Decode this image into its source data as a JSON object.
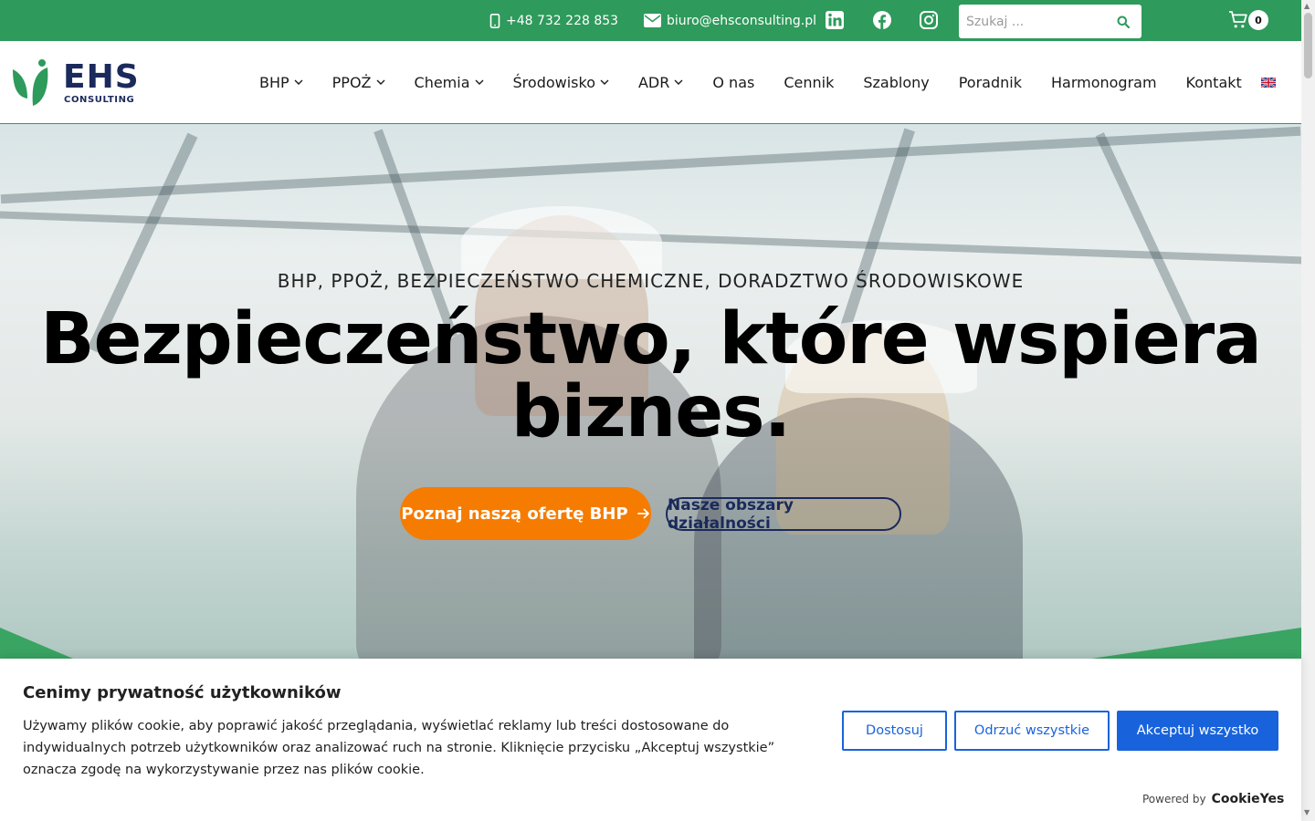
{
  "topbar": {
    "phone": "+48 732 228 853",
    "email": "biuro@ehsconsulting.pl",
    "search_placeholder": "Szukaj ...",
    "cart_count": "0"
  },
  "logo": {
    "main": "EHS",
    "sub": "CONSULTING"
  },
  "nav": {
    "items": [
      {
        "label": "BHP",
        "dropdown": true
      },
      {
        "label": "PPOŻ",
        "dropdown": true
      },
      {
        "label": "Chemia",
        "dropdown": true
      },
      {
        "label": "Środowisko",
        "dropdown": true
      },
      {
        "label": "ADR",
        "dropdown": true
      },
      {
        "label": "O nas",
        "dropdown": false
      },
      {
        "label": "Cennik",
        "dropdown": false
      },
      {
        "label": "Szablony",
        "dropdown": false
      },
      {
        "label": "Poradnik",
        "dropdown": false
      },
      {
        "label": "Harmonogram",
        "dropdown": false
      },
      {
        "label": "Kontakt",
        "dropdown": false
      }
    ]
  },
  "hero": {
    "subtitle": "BHP, PPOŻ, BEZPIECZEŃSTWO CHEMICZNE, DORADZTWO ŚRODOWISKOWE",
    "title_line1": "Bezpieczeństwo, które wspiera",
    "title_line2": "biznes.",
    "primary_button": "Poznaj naszą ofertę BHP",
    "secondary_button": "Nasze obszary działalności"
  },
  "cookie": {
    "title": "Cenimy prywatność użytkowników",
    "text": "Używamy plików cookie, aby poprawić jakość przeglądania, wyświetlać reklamy lub treści dostosowane do indywidualnych potrzeb użytkowników oraz analizować ruch na stronie. Kliknięcie przycisku „Akceptuj wszystkie” oznacza zgodę na wykorzystywanie przez nas plików cookie.",
    "customize": "Dostosuj",
    "reject": "Odrzuć wszystkie",
    "accept": "Akceptuj wszystko",
    "powered_by": "Powered by",
    "powered_brand": "CookieYes"
  },
  "colors": {
    "brand_green": "#2e9a5b",
    "brand_navy": "#1b2a5c",
    "cta_orange": "#f57c00",
    "cookie_blue": "#1863dc"
  }
}
